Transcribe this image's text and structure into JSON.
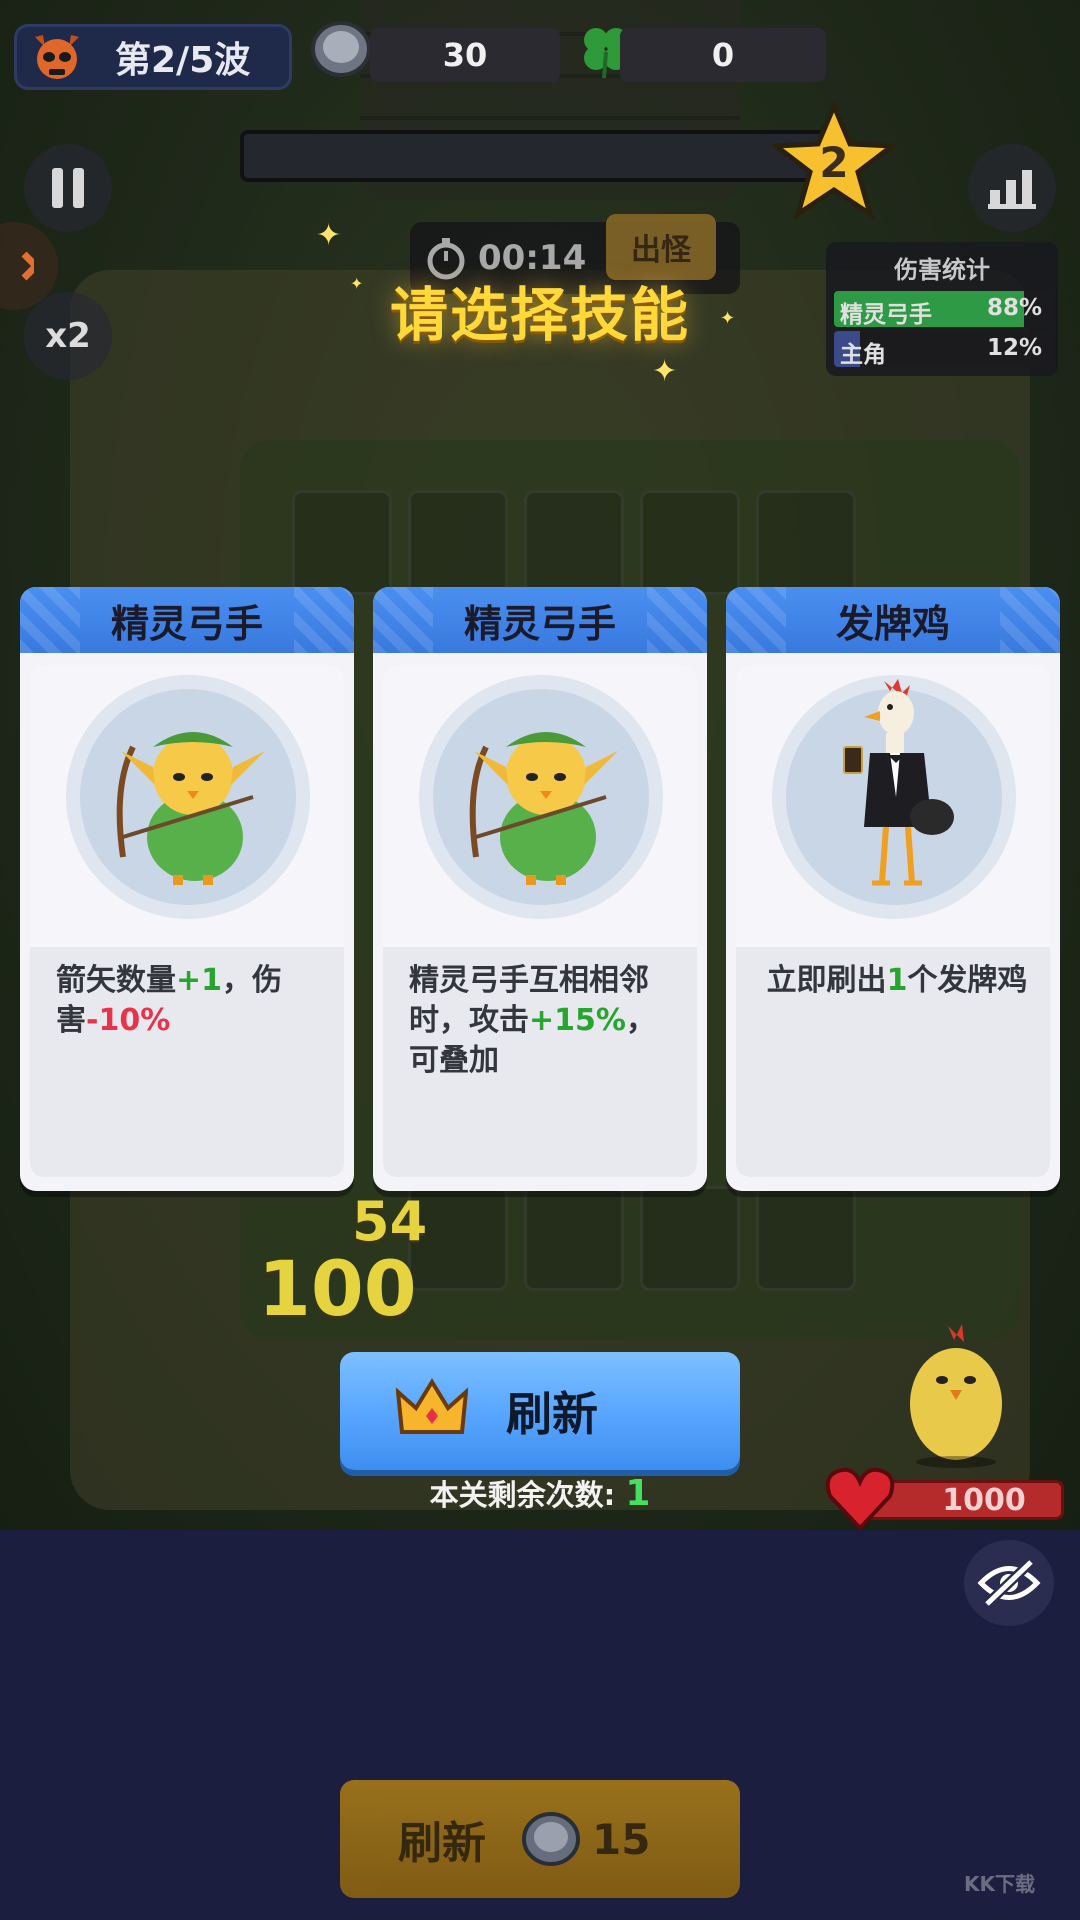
{
  "hud": {
    "wave": "第2/5波",
    "silver": "30",
    "clover": "0",
    "star_level": "2",
    "timer": "00:14",
    "spawn": "出怪",
    "speed": "x2"
  },
  "title": "请选择技能",
  "damage_stats": {
    "title": "伤害统计",
    "rows": [
      {
        "name": "精灵弓手",
        "pct": "88%"
      },
      {
        "name": "主角",
        "pct": "12%"
      }
    ]
  },
  "cards": [
    {
      "title": "精灵弓手",
      "desc_parts": [
        "箭矢数量",
        "+1",
        "，伤害",
        "-10%"
      ]
    },
    {
      "title": "精灵弓手",
      "desc_parts": [
        "精灵弓手互相相邻时，攻击",
        "+15%",
        "，可叠加"
      ]
    },
    {
      "title": "发牌鸡",
      "desc_parts": [
        "立即刷出",
        "1",
        "个发牌鸡"
      ]
    }
  ],
  "floating_numbers": [
    "54",
    "100"
  ],
  "refresh": {
    "label": "刷新",
    "remain_label": "本关剩余次数:",
    "remain_count": "1"
  },
  "player_hp": "1000",
  "buy_refresh": {
    "label": "刷新",
    "cost": "15"
  },
  "watermark": "KK下载"
}
